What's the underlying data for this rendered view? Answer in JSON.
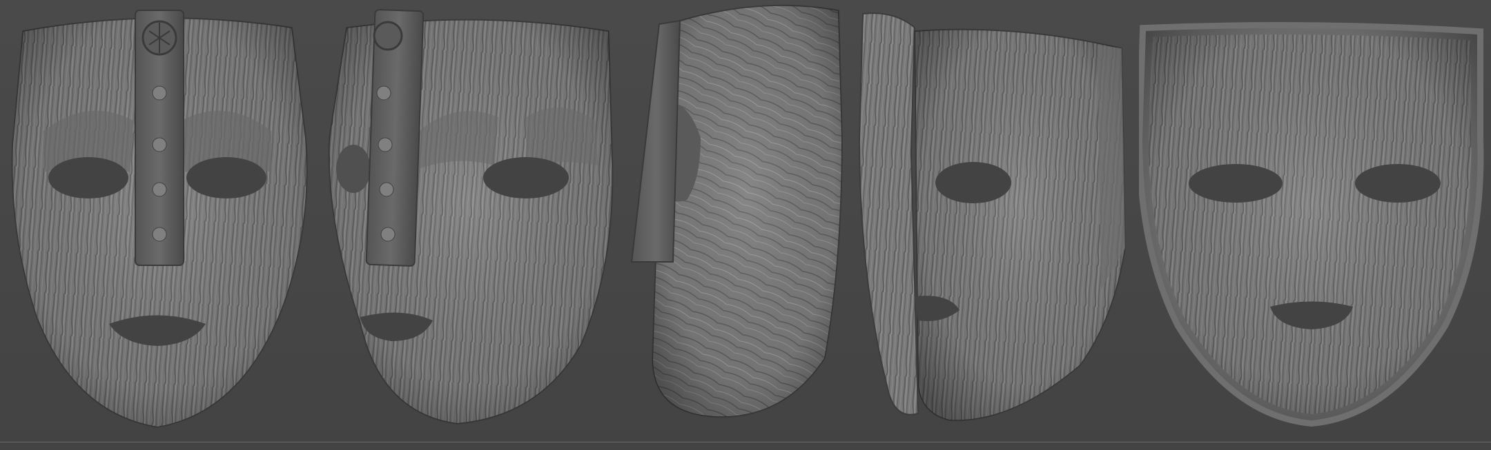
{
  "scene": {
    "background_color": "#464646",
    "material_color": "#7b7b7b",
    "highlight_color": "#a8a8a8",
    "shadow_color": "#353535",
    "views": [
      {
        "name": "front-view",
        "icon": "wooden-mask-front"
      },
      {
        "name": "three-quarter-view",
        "icon": "wooden-mask-three-quarter"
      },
      {
        "name": "side-view",
        "icon": "wooden-mask-profile"
      },
      {
        "name": "rear-three-quarter-view",
        "icon": "wooden-mask-back-angle"
      },
      {
        "name": "back-view",
        "icon": "wooden-mask-back"
      }
    ]
  }
}
